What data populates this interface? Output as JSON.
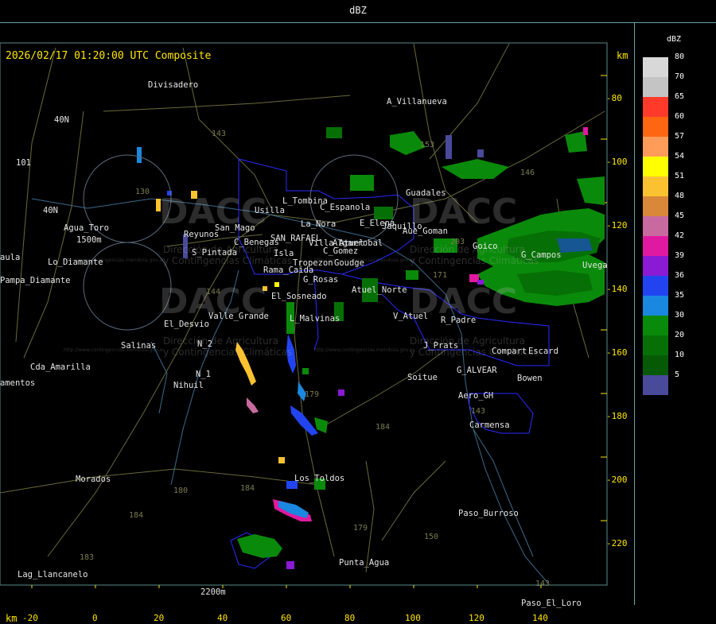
{
  "header": {
    "title": "dBZ"
  },
  "map": {
    "timestamp": "2026/02/17 01:20:00 UTC Composite",
    "unit_top": "km",
    "unit_bottom": "km",
    "x_ticks": [
      "-20",
      "0",
      "20",
      "40",
      "60",
      "80",
      "100",
      "120",
      "140"
    ],
    "y_ticks": [
      "-80",
      "-100",
      "-120",
      "-140",
      "-160",
      "-180",
      "-200",
      "-220"
    ],
    "places": [
      "Divisadero",
      "A_Villanueva",
      "40N",
      "101",
      "40N",
      "Agua_Toro",
      "1500m",
      "Pampa_Diamante",
      "Lo_Diamante",
      "aula",
      "El_Desvio",
      "Salinas",
      "Cda_Amarilla",
      "amentos",
      "Nihuil",
      "N_1",
      "N_2",
      "Valle_Grande",
      "El_Sosneado",
      "Rama_Caida",
      "S_Pintada",
      "Reyunos",
      "San_Mago",
      "C_Benegas",
      "SAN_RAFAEL",
      "Isla",
      "Villa_Atuel",
      "Usilla",
      "L_Tombina",
      "C_Espanola",
      "La_Nora",
      "C_Gomez",
      "E_Elena",
      "Jaquillo",
      "Aue_Goman",
      "Guadales",
      "G_Rosas",
      "L_Malvinas",
      "Atuel_Norte",
      "V_Atuel",
      "R_Padre",
      "J_Prats",
      "Compart",
      "Escard",
      "Soitue",
      "G_ALVEAR",
      "Aero_GH",
      "Bowen",
      "Carmensa",
      "Goico",
      "G_Campos",
      "Uvega",
      "Los_Toldos",
      "Morados",
      "Punta_Agua",
      "Paso_Burroso",
      "Paso_El_Loro",
      "Lag_Llancanelo",
      "2200m",
      "Tropezon",
      "Goudge",
      "Algarrobal"
    ],
    "roads": [
      "143",
      "153",
      "146",
      "203",
      "171",
      "144",
      "179",
      "184",
      "180",
      "184",
      "179",
      "150",
      "143",
      "143",
      "184",
      "183",
      "130"
    ],
    "watermark": {
      "logo": "DACC",
      "line1": "Dirección de Agricultura",
      "line2": "y Contingencias Climáticas",
      "url": "http://www.contingencias.mendoza.gov.ar"
    }
  },
  "legend": {
    "title": "dBZ",
    "levels": [
      {
        "label": "80",
        "color": "#d8d8d8"
      },
      {
        "label": "70",
        "color": "#c4c4c4"
      },
      {
        "label": "65",
        "color": "#ff3a2a"
      },
      {
        "label": "60",
        "color": "#ff6612"
      },
      {
        "label": "57",
        "color": "#ff9c5a"
      },
      {
        "label": "54",
        "color": "#ffff00"
      },
      {
        "label": "51",
        "color": "#fac230"
      },
      {
        "label": "48",
        "color": "#d88838"
      },
      {
        "label": "45",
        "color": "#c86aa0"
      },
      {
        "label": "42",
        "color": "#e01aa0"
      },
      {
        "label": "39",
        "color": "#8a1ad4"
      },
      {
        "label": "36",
        "color": "#2244f0"
      },
      {
        "label": "35",
        "color": "#1a88e0"
      },
      {
        "label": "30",
        "color": "#0a8a0a"
      },
      {
        "label": "20",
        "color": "#067006"
      },
      {
        "label": "10",
        "color": "#065a06"
      },
      {
        "label": "5",
        "color": "#4a4a9a"
      }
    ]
  }
}
